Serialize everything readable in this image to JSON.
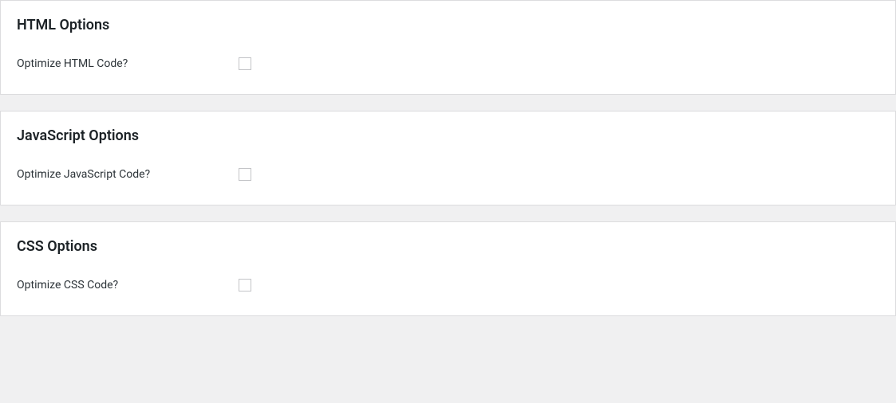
{
  "sections": {
    "html": {
      "title": "HTML Options",
      "optimize_label": "Optimize HTML Code?",
      "optimize_checked": false
    },
    "javascript": {
      "title": "JavaScript Options",
      "optimize_label": "Optimize JavaScript Code?",
      "optimize_checked": false
    },
    "css": {
      "title": "CSS Options",
      "optimize_label": "Optimize CSS Code?",
      "optimize_checked": false
    }
  }
}
